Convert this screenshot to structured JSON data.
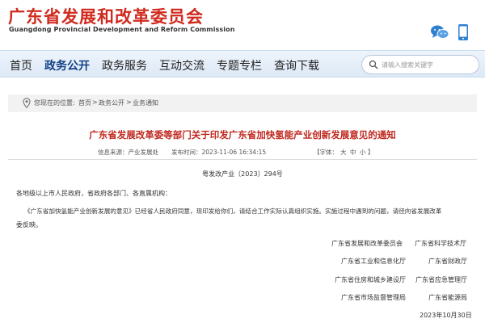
{
  "header": {
    "title_cn": "广东省发展和改革委员会",
    "title_en": "Guangdong Provincial Development and Reform Commission",
    "icons": [
      "wechat-icon",
      "mobile-icon"
    ],
    "brand_color": "#d02a1e"
  },
  "nav": {
    "items": [
      "首页",
      "政务公开",
      "政务服务",
      "互动交流",
      "专题专栏",
      "查询下载"
    ],
    "active": "政务公开",
    "search_placeholder": "请输入搜索关键字"
  },
  "breadcrumb": {
    "prefix": "您现在的位置:",
    "items": [
      "首页",
      "政务公开",
      "业务通知"
    ],
    "separator": ">"
  },
  "article": {
    "title": "广东省发展改革委等部门关于印发广东省加快氢能产业创新发展意见的通知",
    "meta": {
      "source_label": "信息来源：产业发展处",
      "date_label": "发布时间：2023-11-06 16:34:15",
      "font_label": "【字体：",
      "font_large": "大",
      "font_medium": "中",
      "font_small": "小",
      "font_close": "】"
    },
    "doc_number": "粤发改产业〔2023〕294号",
    "salutation": "各地级以上市人民政府，省政府各部门、各直属机构：",
    "body_line1": "《广东省加快氢能产业创新发展的意见》已经省人民政府同意，现印发给你们，请结合工作实际认真组织实施。实施过程中遇到的问题，请径向省发展改革",
    "body_line2": "委反映。",
    "signatories": [
      [
        "广东省发展和改革委员会",
        "广东省科学技术厅"
      ],
      [
        "广东省工业和信息化厅",
        "广东省财政厅"
      ],
      [
        "广东省住房和城乡建设厅",
        "广东省应急管理厅"
      ],
      [
        "广东省市场监督管理局",
        "广东省能源局"
      ]
    ],
    "date": "2023年10月30日"
  }
}
